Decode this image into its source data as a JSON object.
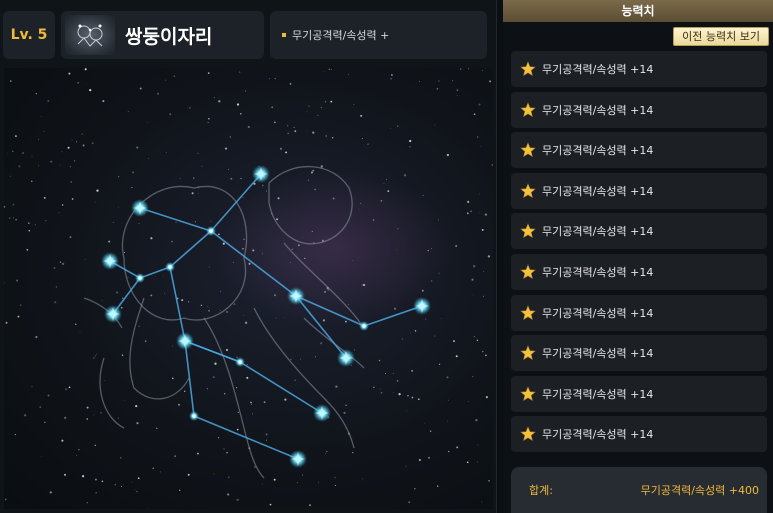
{
  "header": {
    "level": "Lv. 5",
    "constellation_name": "쌍둥이자리",
    "effect_summary": "무기공격력/속성력 +"
  },
  "stats_panel": {
    "title": "능력치",
    "prev_button_label": "이전 능력치 보기",
    "rows": [
      {
        "icon": "star-icon",
        "label": "무기공격력/속성력 +14"
      },
      {
        "icon": "star-icon",
        "label": "무기공격력/속성력 +14"
      },
      {
        "icon": "star-icon",
        "label": "무기공격력/속성력 +14"
      },
      {
        "icon": "star-icon",
        "label": "무기공격력/속성력 +14"
      },
      {
        "icon": "star-icon",
        "label": "무기공격력/속성력 +14"
      },
      {
        "icon": "star-icon",
        "label": "무기공격력/속성력 +14"
      },
      {
        "icon": "star-icon",
        "label": "무기공격력/속성력 +14"
      },
      {
        "icon": "star-icon",
        "label": "무기공격력/속성력 +14"
      },
      {
        "icon": "star-icon",
        "label": "무기공격력/속성력 +14"
      },
      {
        "icon": "star-icon",
        "label": "무기공격력/속성력 +14"
      }
    ],
    "total_label": "합계:",
    "total_value": "무기공격력/속성력 +400"
  },
  "colors": {
    "accent_gold": "#f0b93a",
    "star_glow": "#5fe0ff"
  }
}
